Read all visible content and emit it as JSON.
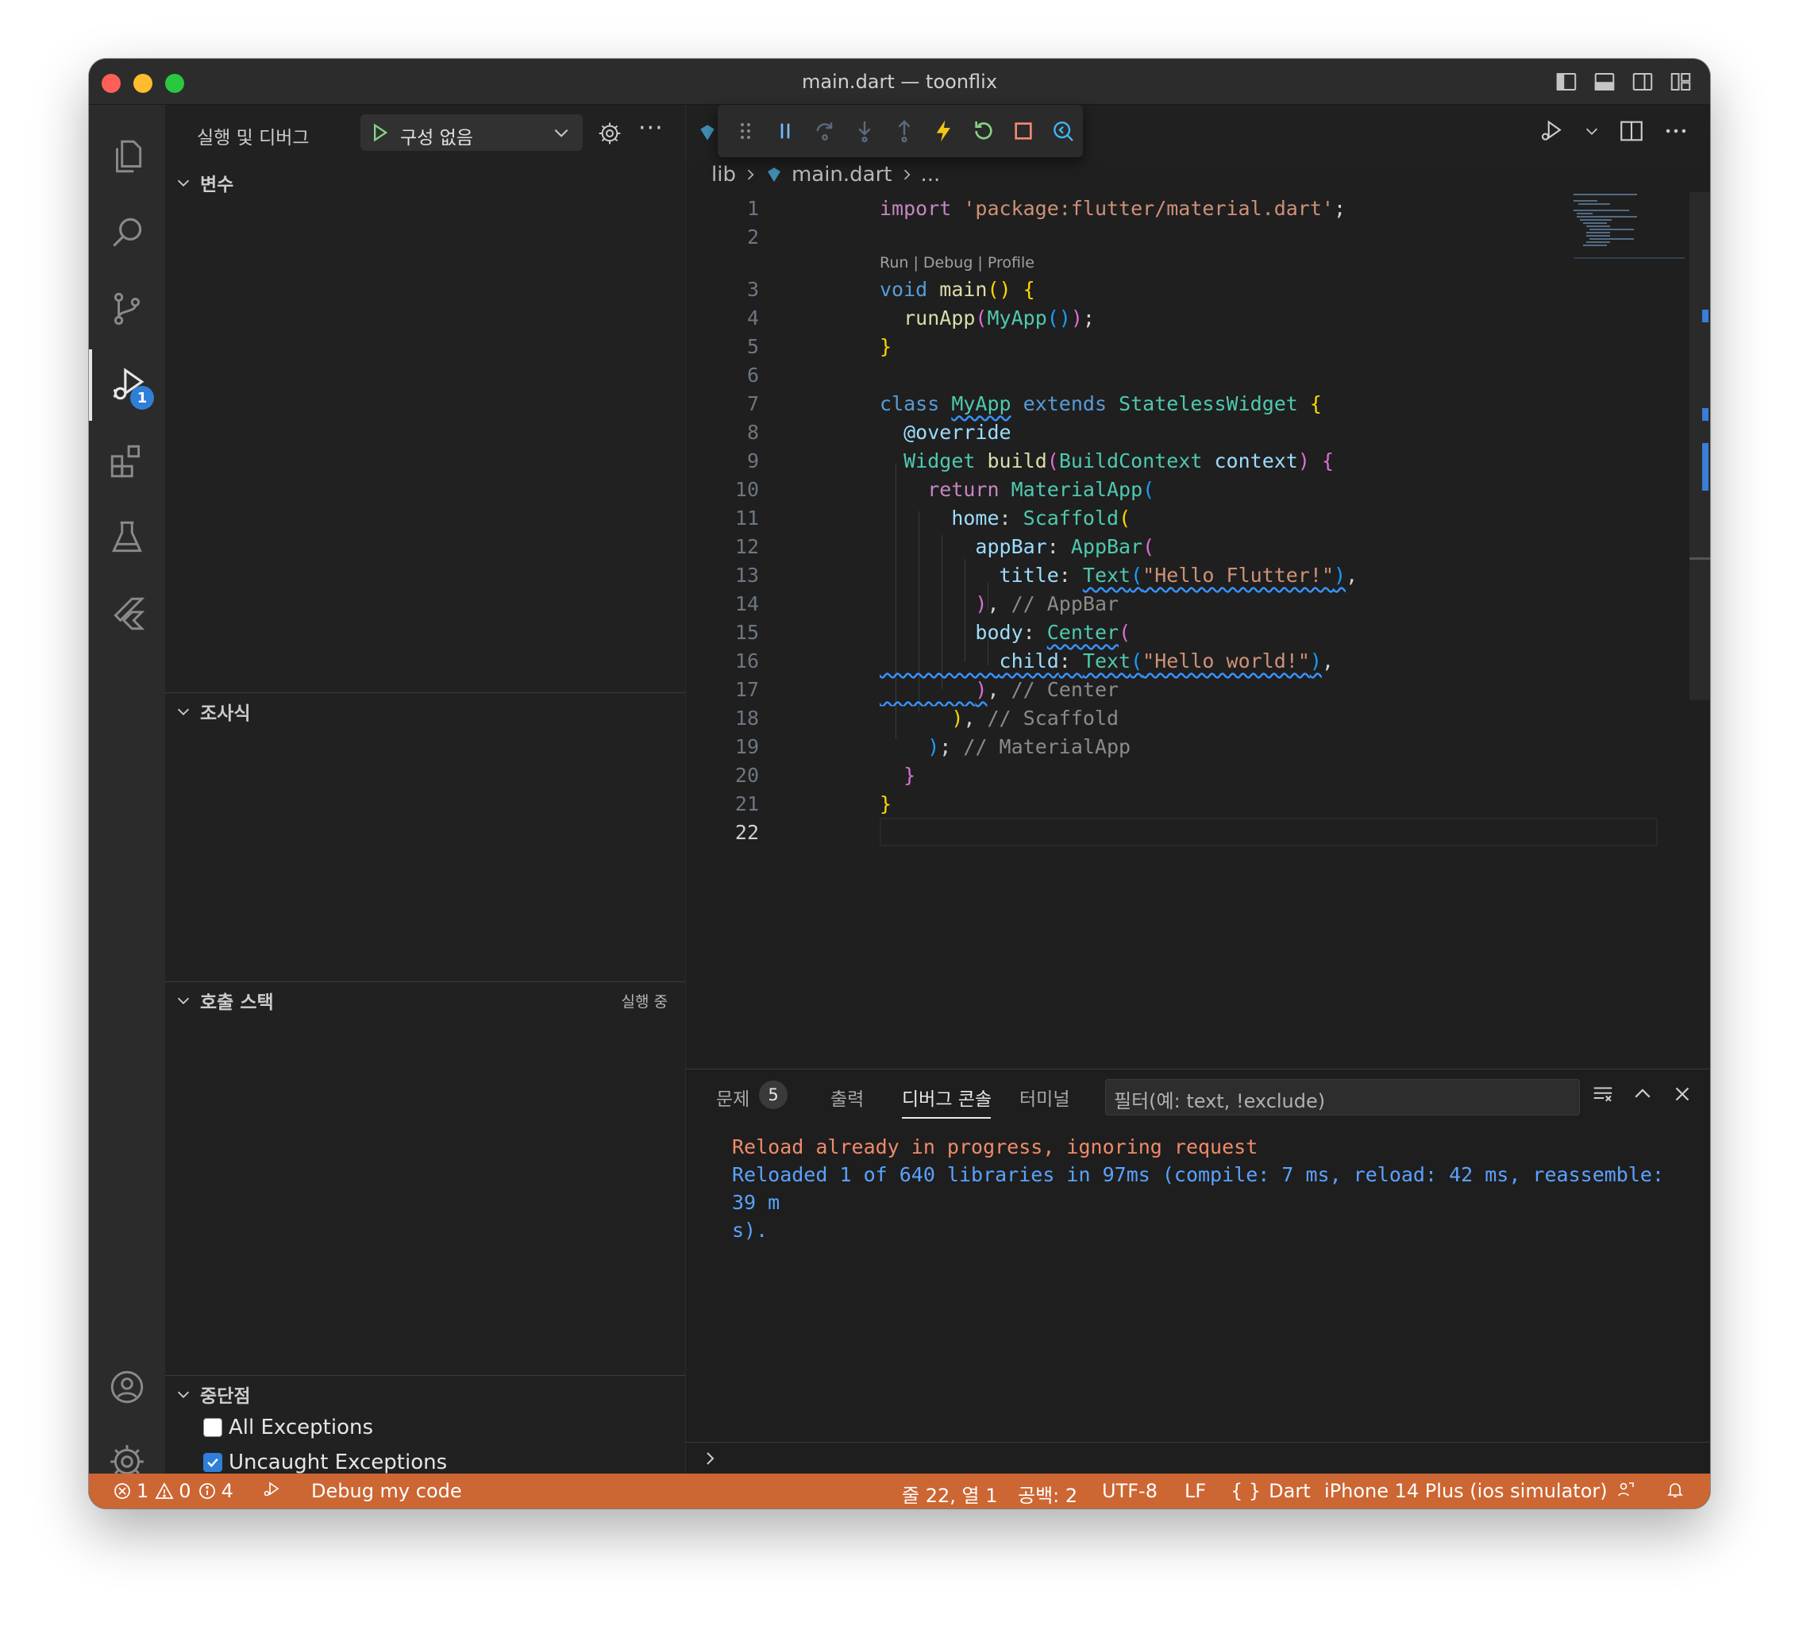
{
  "window": {
    "title": "main.dart — toonflix"
  },
  "sidebar": {
    "title": "실행 및 디버그",
    "config": "구성 없음",
    "sections": {
      "variables": "변수",
      "watch": "조사식",
      "callstack": "호출 스택",
      "callstack_status": "실행 중",
      "breakpoints": "중단점"
    },
    "breakpoints": [
      {
        "label": "All Exceptions",
        "checked": false
      },
      {
        "label": "Uncaught Exceptions",
        "checked": true
      }
    ]
  },
  "activity_bar": {
    "icons": [
      "explorer-icon",
      "search-icon",
      "source-control-icon",
      "run-debug-icon",
      "extensions-icon",
      "testing-icon",
      "flutter-icon",
      "account-icon",
      "manage-gear-icon"
    ],
    "debug_badge": "1"
  },
  "editor": {
    "breadcrumb": [
      "lib",
      "main.dart",
      "..."
    ],
    "codelens": "Run | Debug | Profile",
    "line_numbers": [
      "1",
      "2",
      "3",
      "4",
      "5",
      "6",
      "7",
      "8",
      "9",
      "10",
      "11",
      "12",
      "13",
      "14",
      "15",
      "16",
      "17",
      "18",
      "19",
      "20",
      "21",
      "22"
    ],
    "tokens": {
      "import_kw": "import",
      "import_str": "'package:flutter/material.dart'",
      "void_kw": "void",
      "main_fn": "main",
      "run_app": "runApp",
      "my_app": "MyApp",
      "class_kw": "class",
      "extends_kw": "extends",
      "stateless": "StatelessWidget",
      "override": "@override",
      "widget": "Widget",
      "build_fn": "build",
      "build_context": "BuildContext",
      "context_param": "context",
      "return_kw": "return",
      "material_app": "MaterialApp",
      "home_prop": "home",
      "scaffold": "Scaffold",
      "appbar_prop": "appBar",
      "appbar_cls": "AppBar",
      "title_prop": "title",
      "text_cls": "Text",
      "hello_flutter": "\"Hello Flutter!\"",
      "appbar_comment": "// AppBar",
      "body_prop": "body",
      "center_cls": "Center",
      "child_prop": "child",
      "hello_world": "\"Hello world!\"",
      "center_comment": "// Center",
      "scaffold_comment": "// Scaffold",
      "materialapp_comment": "// MaterialApp"
    }
  },
  "debug_toolbar": [
    "grip-icon",
    "pause-icon",
    "step-over-icon",
    "step-into-icon",
    "step-out-icon",
    "hot-reload-icon",
    "restart-icon",
    "stop-icon",
    "devtools-icon"
  ],
  "panel": {
    "tabs": {
      "problems": "문제",
      "problems_count": "5",
      "output": "출력",
      "debug_console": "디버그 콘솔",
      "terminal": "터미널"
    },
    "filter_placeholder": "필터(예: text, !exclude)",
    "console_lines": [
      {
        "kind": "warn",
        "text": "Reload already in progress, ignoring request"
      },
      {
        "kind": "info",
        "text": "Reloaded 1 of 640 libraries in 97ms (compile: 7 ms, reload: 42 ms, reassemble: 39 m"
      },
      {
        "kind": "info",
        "text": "s)."
      }
    ]
  },
  "status_bar": {
    "errors": "1",
    "warnings": "0",
    "infos": "4",
    "debug_label": "Debug my code",
    "position": "줄 22, 열 1",
    "spaces": "공백: 2",
    "encoding": "UTF-8",
    "eol": "LF",
    "language": "Dart",
    "device": "iPhone 14 Plus (ios simulator)",
    "colors": {
      "background": "#cc6633"
    }
  }
}
